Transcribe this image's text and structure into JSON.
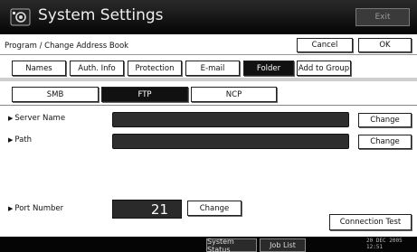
{
  "header": {
    "title": "System Settings",
    "exit_label": "Exit"
  },
  "subheader": {
    "title": "Program / Change Address Book",
    "cancel_label": "Cancel",
    "ok_label": "OK"
  },
  "tabs": [
    {
      "label": "Names"
    },
    {
      "label": "Auth. Info"
    },
    {
      "label": "Protection"
    },
    {
      "label": "E-mail"
    },
    {
      "label": "Folder",
      "selected": true
    },
    {
      "label": "Add to Group"
    }
  ],
  "protocols": [
    {
      "label": "SMB"
    },
    {
      "label": "FTP",
      "selected": true
    },
    {
      "label": "NCP"
    }
  ],
  "fields": {
    "server_name_label": "Server Name",
    "path_label": "Path",
    "port_number_label": "Port Number",
    "server_name_value": "",
    "path_value": "",
    "port_value": "21",
    "change_label": "Change"
  },
  "connection_test_label": "Connection Test",
  "footer": {
    "system_status_label": "System Status",
    "job_list_label": "Job List",
    "date": "20 DEC  2005",
    "time": "12:51"
  }
}
